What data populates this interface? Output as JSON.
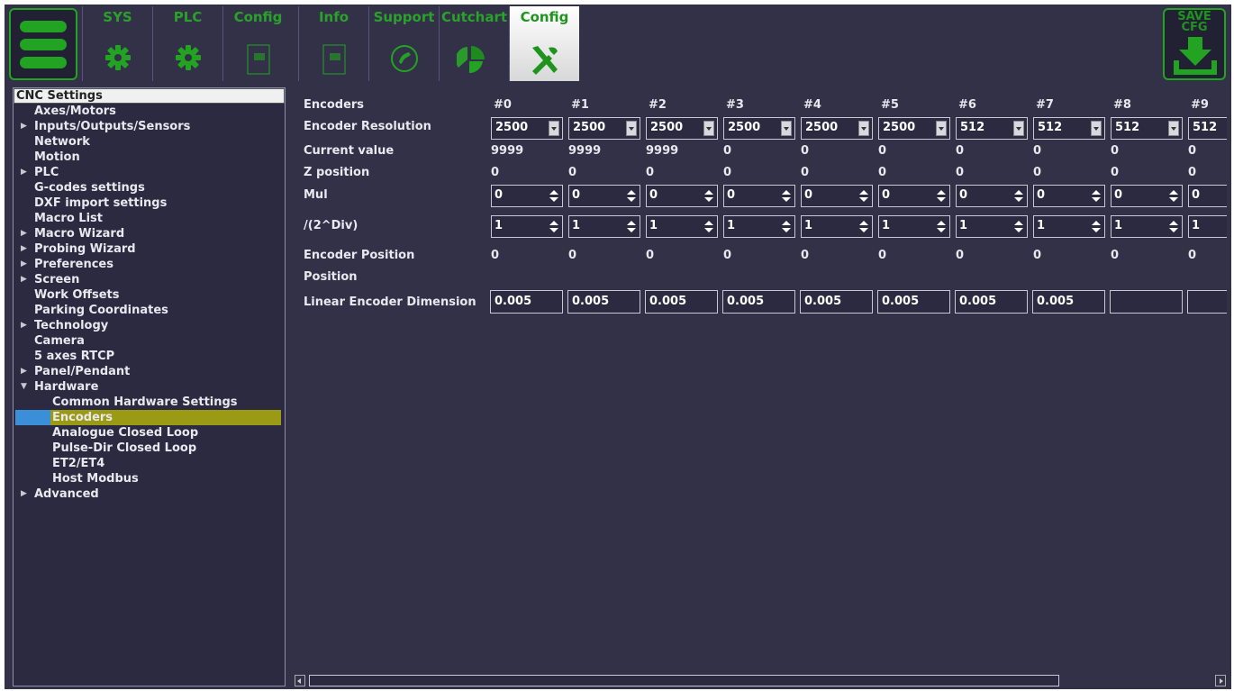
{
  "toolbar": {
    "tabs": [
      {
        "label": "SYS",
        "icon": "gear-icon"
      },
      {
        "label": "PLC",
        "icon": "gear-icon"
      },
      {
        "label": "Config",
        "icon": "document-icon"
      },
      {
        "label": "Info",
        "icon": "document-icon"
      },
      {
        "label": "Support",
        "icon": "phone-icon"
      },
      {
        "label": "Cutchart",
        "icon": "pie-chart-icon"
      },
      {
        "label": "Config",
        "icon": "tools-icon",
        "active": true
      }
    ],
    "save_label_1": "SAVE",
    "save_label_2": "CFG",
    "accent": "#22a322"
  },
  "tree": {
    "title": "CNC Settings",
    "items": [
      {
        "label": "Axes/Motors",
        "arrow": ""
      },
      {
        "label": "Inputs/Outputs/Sensors",
        "arrow": "▶"
      },
      {
        "label": "Network",
        "arrow": ""
      },
      {
        "label": "Motion",
        "arrow": ""
      },
      {
        "label": "PLC",
        "arrow": "▶"
      },
      {
        "label": "G-codes settings",
        "arrow": ""
      },
      {
        "label": "DXF import settings",
        "arrow": ""
      },
      {
        "label": "Macro List",
        "arrow": ""
      },
      {
        "label": "Macro Wizard",
        "arrow": "▶"
      },
      {
        "label": "Probing Wizard",
        "arrow": "▶"
      },
      {
        "label": "Preferences",
        "arrow": "▶"
      },
      {
        "label": "Screen",
        "arrow": "▶"
      },
      {
        "label": "Work Offsets",
        "arrow": ""
      },
      {
        "label": "Parking Coordinates",
        "arrow": ""
      },
      {
        "label": "Technology",
        "arrow": "▶"
      },
      {
        "label": "Camera",
        "arrow": ""
      },
      {
        "label": "5 axes RTCP",
        "arrow": ""
      },
      {
        "label": "Panel/Pendant",
        "arrow": "▶"
      },
      {
        "label": "Hardware",
        "arrow": "▼"
      },
      {
        "label": "Common Hardware Settings",
        "arrow": "",
        "child": true
      },
      {
        "label": "Encoders",
        "arrow": "",
        "child": true,
        "selected": true
      },
      {
        "label": "Analogue Closed Loop",
        "arrow": "",
        "child": true
      },
      {
        "label": "Pulse-Dir Closed Loop",
        "arrow": "",
        "child": true
      },
      {
        "label": "ET2/ET4",
        "arrow": "",
        "child": true
      },
      {
        "label": "Host Modbus",
        "arrow": "",
        "child": true
      },
      {
        "label": "Advanced",
        "arrow": "▶"
      }
    ]
  },
  "encoders": {
    "header_label": "Encoders",
    "columns": [
      "#0",
      "#1",
      "#2",
      "#3",
      "#4",
      "#5",
      "#6",
      "#7",
      "#8",
      "#9"
    ],
    "rows": {
      "resolution_label": "Encoder Resolution",
      "resolution": [
        "2500",
        "2500",
        "2500",
        "2500",
        "2500",
        "2500",
        "512",
        "512",
        "512",
        "512"
      ],
      "current_label": "Current value",
      "current": [
        "9999",
        "9999",
        "9999",
        "0",
        "0",
        "0",
        "0",
        "0",
        "0",
        "0"
      ],
      "z_label": "Z position",
      "z": [
        "0",
        "0",
        "0",
        "0",
        "0",
        "0",
        "0",
        "0",
        "0",
        "0"
      ],
      "mul_label": "Mul",
      "mul": [
        "0",
        "0",
        "0",
        "0",
        "0",
        "0",
        "0",
        "0",
        "0",
        "0"
      ],
      "div_label": "/(2^Div)",
      "div": [
        "1",
        "1",
        "1",
        "1",
        "1",
        "1",
        "1",
        "1",
        "1",
        "1"
      ],
      "encpos_label": "Encoder Position",
      "encpos": [
        "0",
        "0",
        "0",
        "0",
        "0",
        "0",
        "0",
        "0",
        "0",
        "0"
      ],
      "position_label": "Position",
      "lin_label": "Linear Encoder Dimension",
      "lin": [
        "0.005",
        "0.005",
        "0.005",
        "0.005",
        "0.005",
        "0.005",
        "0.005",
        "0.005",
        "",
        ""
      ]
    }
  }
}
